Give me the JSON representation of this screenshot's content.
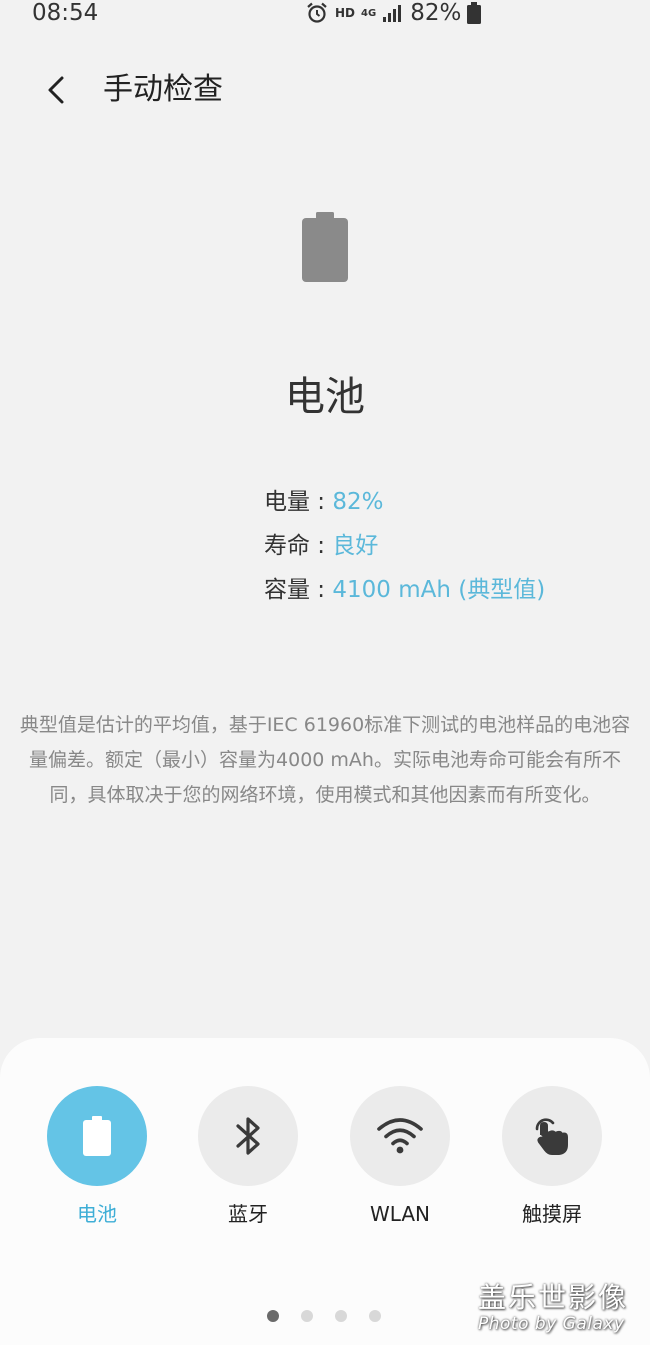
{
  "status_bar": {
    "time": "08:54",
    "hd": "HD",
    "network": "4G",
    "battery": "82%"
  },
  "header": {
    "title": "手动检查"
  },
  "icons": {
    "back": "back-arrow-icon",
    "battery": "battery-icon",
    "bluetooth": "bluetooth-icon",
    "wifi": "wifi-icon",
    "touch": "touch-hand-icon"
  },
  "main": {
    "section_title": "电池",
    "info": [
      {
        "label": "电量 : ",
        "value": "82%"
      },
      {
        "label": "寿命 : ",
        "value": "良好"
      },
      {
        "label": "容量 : ",
        "value": "4100 mAh (典型值)"
      }
    ],
    "description": "典型值是估计的平均值，基于IEC 61960标准下测试的电池样品的电池容量偏差。额定（最小）容量为4000 mAh。实际电池寿命可能会有所不同，具体取决于您的网络环境，使用模式和其他因素而有所变化。"
  },
  "tabs": [
    {
      "label": "电池",
      "active": true
    },
    {
      "label": "蓝牙",
      "active": false
    },
    {
      "label": "WLAN",
      "active": false
    },
    {
      "label": "触摸屏",
      "active": false
    }
  ],
  "pager": {
    "count": 4,
    "active_index": 0
  },
  "colors": {
    "accent": "#64c4e6",
    "accent_text": "#5bb8da",
    "background": "#f2f2f2"
  },
  "watermark": {
    "line1": "盖乐世影像",
    "line2": "Photo by Galaxy"
  }
}
